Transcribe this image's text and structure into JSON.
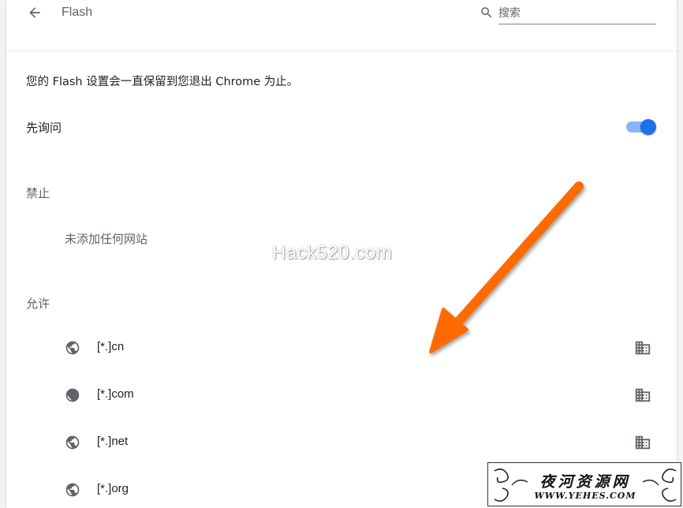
{
  "header": {
    "title": "Flash",
    "search_placeholder": "搜索",
    "search_value": ""
  },
  "content": {
    "note": "您的 Flash 设置会一直保留到您退出 Chrome 为止。",
    "ask_first": {
      "label": "先询问",
      "enabled": true
    },
    "block": {
      "label": "禁止",
      "empty_text": "未添加任何网站"
    },
    "allow": {
      "label": "允许",
      "sites": [
        {
          "name": "[*.]cn"
        },
        {
          "name": "[*.]com"
        },
        {
          "name": "[*.]net"
        },
        {
          "name": "[*.]org"
        }
      ]
    }
  },
  "overlay": {
    "watermark": "Hack520.com",
    "badge_title": "夜河资源网",
    "badge_url": "WWW.YEHES.COM",
    "arrow_color": "#ff6a00"
  },
  "colors": {
    "accent": "#1a73e8",
    "toggle_track": "#8ab4f8",
    "icon": "#5f6368"
  }
}
